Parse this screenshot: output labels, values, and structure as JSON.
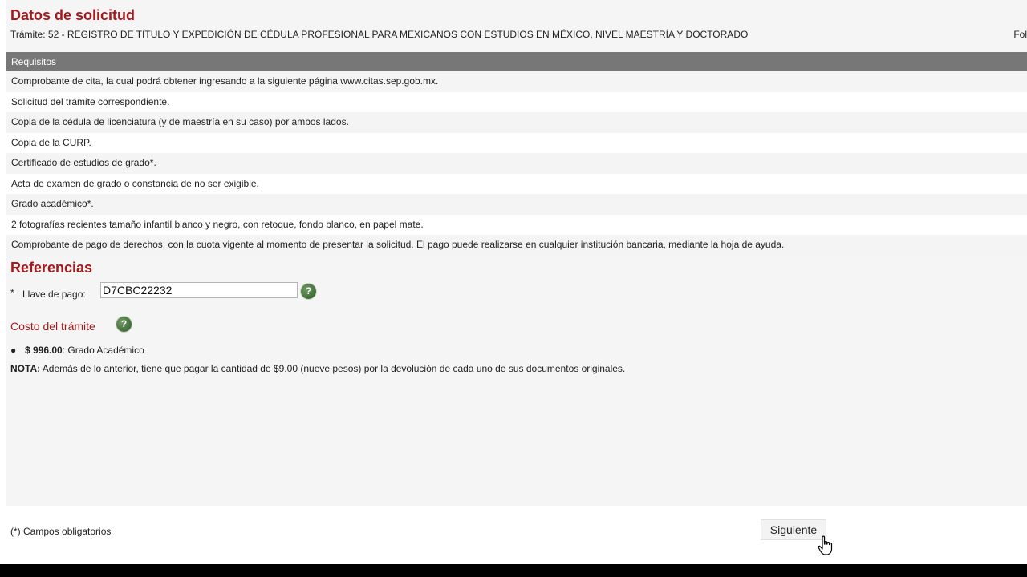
{
  "section": {
    "title": "Datos de solicitud",
    "tramite": "Trámite: 52 - REGISTRO DE TÍTULO Y EXPEDICIÓN DE CÉDULA PROFESIONAL PARA MEXICANOS CON ESTUDIOS EN MÉXICO, NIVEL MAESTRÍA Y DOCTORADO",
    "fol_label": "Fol"
  },
  "requisitos": {
    "header": "Requisitos",
    "items": [
      "Comprobante de cita, la cual podrá obtener ingresando a la siguiente página www.citas.sep.gob.mx.",
      "Solicitud del trámite correspondiente.",
      "Copia de la cédula de licenciatura (y de maestría en su caso) por ambos lados.",
      "Copia de la CURP.",
      "Certificado de estudios de grado*.",
      "Acta de examen de grado o constancia de no ser exigible.",
      "Grado académico*.",
      "2 fotografías recientes tamaño infantil blanco y negro, con retoque, fondo blanco, en papel mate.",
      "Comprobante de pago de derechos, con la cuota vigente al momento de presentar la solicitud. El pago puede realizarse en cualquier institución bancaria, mediante la hoja de ayuda."
    ]
  },
  "referencias": {
    "title": "Referencias",
    "required_mark": "*",
    "llave_label": "Llave de pago:",
    "llave_value": "D7CBC22232",
    "help_symbol": "?"
  },
  "costo": {
    "title": "Costo del trámite",
    "bullet": "●",
    "amount": "$ 996.00",
    "amount_desc": ": Grado Académico",
    "nota_label": "NOTA:",
    "nota_text": " Además de lo anterior, tiene que pagar la cantidad de $9.00 (nueve pesos) por la devolución de cada uno de sus documentos originales."
  },
  "footer": {
    "required_note": "(*) Campos obligatorios",
    "next_label": "Siguiente"
  },
  "icons": {
    "help": "help-circle-icon",
    "cursor": "hand-pointer-icon"
  },
  "colors": {
    "heading": "#a5191c",
    "table_header": "#777777",
    "help_green": "#3f6b37"
  }
}
